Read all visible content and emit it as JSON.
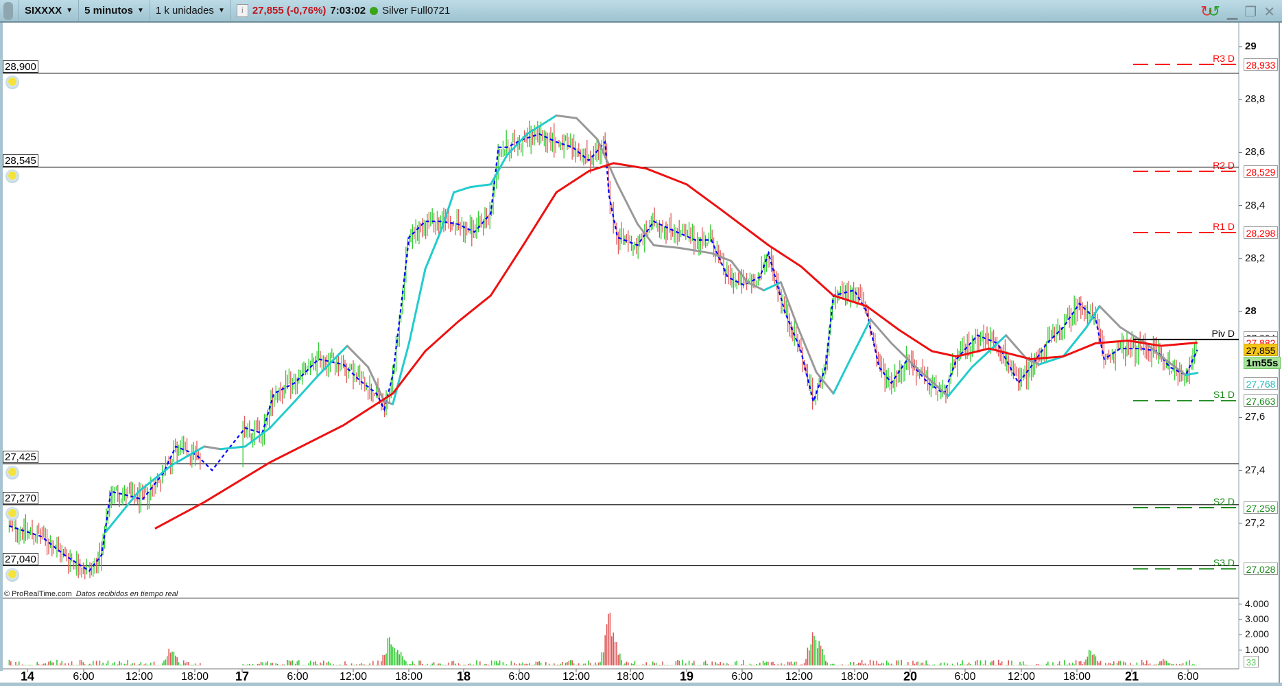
{
  "toolbar": {
    "instrument": "SIXXXX",
    "timeframe": "5 minutos",
    "units": "1 k unidades",
    "last_price": "27,855 (-0,76%)",
    "time": "7:03:02",
    "connection_status_color": "#3aa517",
    "account": "Silver Full0721",
    "icons": [
      "link-icon",
      "info-icon",
      "refresh-icon",
      "minimize-icon",
      "restore-icon",
      "close-icon"
    ]
  },
  "alerts": [
    {
      "label": "28,900",
      "price": 28.9
    },
    {
      "label": "28,545",
      "price": 28.545
    },
    {
      "label": "27,425",
      "price": 27.425
    },
    {
      "label": "27,270",
      "price": 27.27
    },
    {
      "label": "27,040",
      "price": 27.04
    }
  ],
  "pivots": [
    {
      "name": "R3 D",
      "label": "28,933",
      "price": 28.933,
      "color": "#ff0000"
    },
    {
      "name": "R2 D",
      "label": "28,529",
      "price": 28.529,
      "color": "#ff0000"
    },
    {
      "name": "R1 D",
      "label": "28,298",
      "price": 28.298,
      "color": "#ff0000"
    },
    {
      "name": "Piv D",
      "label": "27,894",
      "price": 27.894,
      "color": "#000000"
    },
    {
      "name": "S1 D",
      "label": "27,663",
      "price": 27.663,
      "color": "#1a8a1a"
    },
    {
      "name": "S2 D",
      "label": "27,259",
      "price": 27.259,
      "color": "#1a8a1a"
    },
    {
      "name": "S3 D",
      "label": "27,028",
      "price": 27.028,
      "color": "#1a8a1a"
    }
  ],
  "price_axis": {
    "ticks": [
      "29",
      "28,8",
      "28,6",
      "28,4",
      "28,2",
      "28",
      "27,6",
      "27,4",
      "27,2"
    ],
    "tick_values": [
      29,
      28.8,
      28.6,
      28.4,
      28.2,
      28,
      27.6,
      27.4,
      27.2
    ],
    "badges": {
      "slow_ma": "27,882",
      "current": "27,855",
      "countdown": "1m55s",
      "medium_ma": "27,768"
    }
  },
  "volume_axis": {
    "ticks": [
      "4.000",
      "3.000",
      "2.000",
      "1.000"
    ],
    "tick_values": [
      4000,
      3000,
      2000,
      1000
    ],
    "current": "33"
  },
  "time_axis": [
    {
      "label": "14",
      "bold": true
    },
    {
      "label": "6:00"
    },
    {
      "label": "12:00"
    },
    {
      "label": "18:00"
    },
    {
      "label": "17",
      "bold": true
    },
    {
      "label": "6:00"
    },
    {
      "label": "12:00"
    },
    {
      "label": "18:00"
    },
    {
      "label": "18",
      "bold": true
    },
    {
      "label": "6:00"
    },
    {
      "label": "12:00"
    },
    {
      "label": "18:00"
    },
    {
      "label": "19",
      "bold": true
    },
    {
      "label": "6:00"
    },
    {
      "label": "12:00"
    },
    {
      "label": "18:00"
    },
    {
      "label": "20",
      "bold": true
    },
    {
      "label": "6:00"
    },
    {
      "label": "12:00"
    },
    {
      "label": "18:00"
    },
    {
      "label": "21",
      "bold": true
    },
    {
      "label": "6:00"
    }
  ],
  "footer": {
    "copyright": "© ProRealTime.com",
    "note": "Datos recibidos en tiempo real"
  },
  "chart_data": {
    "type": "candlestick",
    "ylim": [
      26.95,
      29.05
    ],
    "colors": {
      "up": "#33cc33",
      "down": "#e05a5a",
      "fast_ma": "#0000ff",
      "medium_ma_rising": "#22cccc",
      "medium_ma_falling": "#999999",
      "slow_ma": "#ee1111"
    },
    "price_path": [
      [
        "13 22:00",
        27.19
      ],
      [
        "14 01:30",
        27.15
      ],
      [
        "14 04:00",
        27.08
      ],
      [
        "14 06:40",
        27.02
      ],
      [
        "14 08:00",
        27.08
      ],
      [
        "14 09:00",
        27.32
      ],
      [
        "14 10:15",
        27.31
      ],
      [
        "14 12:25",
        27.29
      ],
      [
        "14 14:40",
        27.39
      ],
      [
        "14 16:00",
        27.49
      ],
      [
        "14 18:10",
        27.46
      ],
      [
        "14 19:55",
        27.4
      ],
      [
        "14 21:40",
        27.48
      ],
      [
        "17 00:20",
        27.56
      ],
      [
        "17 02:10",
        27.54
      ],
      [
        "17 03:25",
        27.69
      ],
      [
        "17 05:40",
        27.73
      ],
      [
        "17 08:15",
        27.82
      ],
      [
        "17 10:55",
        27.8
      ],
      [
        "17 12:40",
        27.74
      ],
      [
        "17 14:30",
        27.69
      ],
      [
        "17 15:20",
        27.63
      ],
      [
        "17 16:15",
        27.76
      ],
      [
        "17 17:05",
        28.0
      ],
      [
        "17 18:00",
        28.28
      ],
      [
        "17 19:45",
        28.34
      ],
      [
        "17 21:30",
        28.34
      ],
      [
        "17 23:15",
        28.33
      ],
      [
        "18 01:10",
        28.3
      ],
      [
        "18 02:55",
        28.37
      ],
      [
        "18 03:45",
        28.62
      ],
      [
        "18 04:40",
        28.62
      ],
      [
        "18 06:25",
        28.65
      ],
      [
        "18 08:10",
        28.67
      ],
      [
        "18 10:00",
        28.64
      ],
      [
        "18 11:45",
        28.62
      ],
      [
        "18 13:30",
        28.57
      ],
      [
        "18 15:15",
        28.64
      ],
      [
        "18 15:40",
        28.44
      ],
      [
        "18 16:35",
        28.28
      ],
      [
        "18 18:45",
        28.25
      ],
      [
        "18 20:30",
        28.34
      ],
      [
        "18 22:20",
        28.31
      ],
      [
        "19 00:55",
        28.27
      ],
      [
        "19 02:40",
        28.27
      ],
      [
        "19 04:25",
        28.13
      ],
      [
        "19 06:10",
        28.1
      ],
      [
        "19 07:55",
        28.13
      ],
      [
        "19 08:50",
        28.22
      ],
      [
        "19 10:35",
        28.0
      ],
      [
        "19 12:20",
        27.85
      ],
      [
        "19 13:40",
        27.66
      ],
      [
        "19 15:00",
        27.79
      ],
      [
        "19 15:50",
        28.06
      ],
      [
        "19 18:05",
        28.08
      ],
      [
        "19 19:25",
        28.0
      ],
      [
        "19 20:45",
        27.79
      ],
      [
        "19 22:05",
        27.73
      ],
      [
        "19 23:50",
        27.82
      ],
      [
        "20 01:55",
        27.73
      ],
      [
        "20 03:40",
        27.69
      ],
      [
        "20 05:00",
        27.82
      ],
      [
        "20 07:15",
        27.91
      ],
      [
        "20 09:25",
        27.88
      ],
      [
        "20 11:40",
        27.73
      ],
      [
        "20 13:00",
        27.79
      ],
      [
        "20 14:45",
        27.88
      ],
      [
        "20 16:30",
        27.94
      ],
      [
        "20 18:15",
        28.03
      ],
      [
        "20 20:00",
        27.97
      ],
      [
        "20 20:55",
        27.82
      ],
      [
        "20 22:40",
        27.86
      ],
      [
        "21 01:00",
        27.86
      ],
      [
        "21 02:45",
        27.85
      ],
      [
        "21 04:05",
        27.79
      ],
      [
        "21 05:50",
        27.76
      ],
      [
        "21 07:05",
        27.855
      ]
    ],
    "medium_ma": [
      [
        "14 08:30",
        27.17
      ],
      [
        "14 12:00",
        27.32
      ],
      [
        "14 15:35",
        27.42
      ],
      [
        "14 19:05",
        27.49
      ],
      [
        "14 20:50",
        27.48
      ],
      [
        "17 00:20",
        27.49
      ],
      [
        "17 03:00",
        27.56
      ],
      [
        "17 05:40",
        27.66
      ],
      [
        "17 08:15",
        27.76
      ],
      [
        "17 11:20",
        27.87
      ],
      [
        "17 13:35",
        27.79
      ],
      [
        "17 15:20",
        27.66
      ],
      [
        "17 16:15",
        27.65
      ],
      [
        "17 18:00",
        27.88
      ],
      [
        "17 19:45",
        28.16
      ],
      [
        "17 21:30",
        28.31
      ],
      [
        "17 22:50",
        28.45
      ],
      [
        "18 00:45",
        28.47
      ],
      [
        "18 02:55",
        28.48
      ],
      [
        "18 04:40",
        28.59
      ],
      [
        "18 06:50",
        28.67
      ],
      [
        "18 10:00",
        28.74
      ],
      [
        "18 12:10",
        28.73
      ],
      [
        "18 14:25",
        28.65
      ],
      [
        "18 16:35",
        28.48
      ],
      [
        "18 18:45",
        28.33
      ],
      [
        "18 20:30",
        28.25
      ],
      [
        "18 23:15",
        28.24
      ],
      [
        "19 02:40",
        28.22
      ],
      [
        "19 04:50",
        28.19
      ],
      [
        "19 06:35",
        28.11
      ],
      [
        "19 08:20",
        28.08
      ],
      [
        "19 10:10",
        28.11
      ],
      [
        "19 12:00",
        27.94
      ],
      [
        "19 14:00",
        27.77
      ],
      [
        "19 15:50",
        27.69
      ],
      [
        "19 17:40",
        27.82
      ],
      [
        "19 19:50",
        27.97
      ],
      [
        "19 22:05",
        27.88
      ],
      [
        "20 00:35",
        27.79
      ],
      [
        "20 04:05",
        27.68
      ],
      [
        "20 06:40",
        27.79
      ],
      [
        "20 10:20",
        27.91
      ],
      [
        "20 12:35",
        27.82
      ],
      [
        "20 13:55",
        27.8
      ],
      [
        "20 16:30",
        27.83
      ],
      [
        "20 19:00",
        27.94
      ],
      [
        "20 20:25",
        28.02
      ],
      [
        "20 22:40",
        27.94
      ],
      [
        "21 01:30",
        27.88
      ],
      [
        "21 03:10",
        27.83
      ],
      [
        "21 05:50",
        27.76
      ],
      [
        "21 07:05",
        27.768
      ]
    ],
    "slow_ma": [
      [
        "14 13:45",
        27.18
      ],
      [
        "14 19:05",
        27.28
      ],
      [
        "17 03:00",
        27.43
      ],
      [
        "17 10:55",
        27.57
      ],
      [
        "17 16:15",
        27.69
      ],
      [
        "17 19:45",
        27.85
      ],
      [
        "17 23:15",
        27.96
      ],
      [
        "18 02:55",
        28.06
      ],
      [
        "18 06:25",
        28.25
      ],
      [
        "18 10:00",
        28.45
      ],
      [
        "18 13:30",
        28.53
      ],
      [
        "18 16:10",
        28.56
      ],
      [
        "18 19:40",
        28.54
      ],
      [
        "19 00:00",
        28.48
      ],
      [
        "19 03:30",
        28.39
      ],
      [
        "19 08:50",
        28.25
      ],
      [
        "19 12:20",
        28.17
      ],
      [
        "19 15:50",
        28.06
      ],
      [
        "19 19:25",
        28.02
      ],
      [
        "19 22:55",
        27.93
      ],
      [
        "20 02:20",
        27.85
      ],
      [
        "20 05:00",
        27.83
      ],
      [
        "20 08:30",
        27.86
      ],
      [
        "20 13:00",
        27.82
      ],
      [
        "20 16:30",
        27.83
      ],
      [
        "20 20:00",
        27.88
      ],
      [
        "20 23:30",
        27.89
      ],
      [
        "21 03:10",
        27.87
      ],
      [
        "21 07:05",
        27.882
      ]
    ],
    "volume_ylim": [
      0,
      4200
    ],
    "volume_peaks": [
      [
        "14 15:30",
        1500
      ],
      [
        "14 19:30",
        1100
      ],
      [
        "17 15:50",
        2100
      ],
      [
        "17 16:40",
        1700
      ],
      [
        "18 15:40",
        3900
      ],
      [
        "18 16:10",
        2500
      ],
      [
        "19 13:40",
        2900
      ],
      [
        "19 14:10",
        2200
      ],
      [
        "20 19:30",
        1300
      ],
      [
        "21 03:30",
        500
      ]
    ]
  }
}
